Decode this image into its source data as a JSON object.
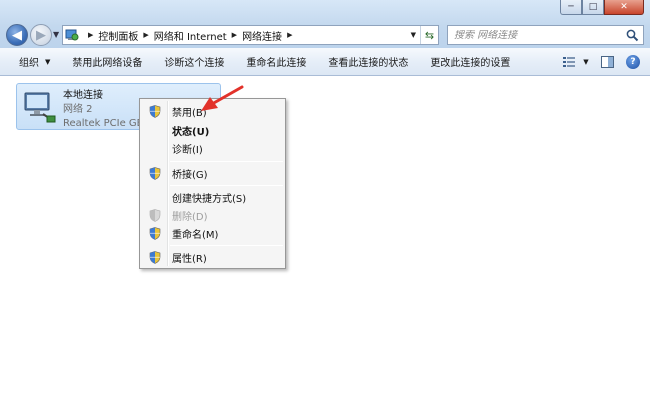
{
  "window": {
    "controls": {
      "minimize": "─",
      "maximize": "□",
      "close": "✕"
    },
    "accent": "#3c6fb8"
  },
  "nav": {
    "breadcrumb": [
      "控制面板",
      "网络和 Internet",
      "网络连接"
    ],
    "search_placeholder": "搜索 网络连接"
  },
  "toolbar": {
    "items": [
      {
        "label": "组织",
        "has_dropdown": true
      },
      {
        "label": "禁用此网络设备"
      },
      {
        "label": "诊断这个连接"
      },
      {
        "label": "重命名此连接"
      },
      {
        "label": "查看此连接的状态"
      },
      {
        "label": "更改此连接的设置"
      }
    ],
    "help_label": "?"
  },
  "connection": {
    "name": "本地连接",
    "network": "网络  2",
    "adapter": "Realtek PCIe GB"
  },
  "context_menu": {
    "items": [
      {
        "label": "禁用(B)",
        "icon": "uac-shield-icon",
        "bold": false,
        "disabled": false
      },
      {
        "label": "状态(U)",
        "icon": "",
        "bold": true,
        "disabled": false
      },
      {
        "label": "诊断(I)",
        "icon": "",
        "bold": false,
        "disabled": false
      },
      {
        "label": "桥接(G)",
        "icon": "uac-shield-icon",
        "bold": false,
        "disabled": false
      },
      {
        "label": "创建快捷方式(S)",
        "icon": "",
        "bold": false,
        "disabled": false
      },
      {
        "label": "删除(D)",
        "icon": "uac-shield-icon",
        "bold": false,
        "disabled": true
      },
      {
        "label": "重命名(M)",
        "icon": "uac-shield-icon",
        "bold": false,
        "disabled": false
      },
      {
        "label": "属性(R)",
        "icon": "uac-shield-icon",
        "bold": false,
        "disabled": false
      }
    ]
  },
  "annotation": {
    "color": "#e2322a"
  }
}
